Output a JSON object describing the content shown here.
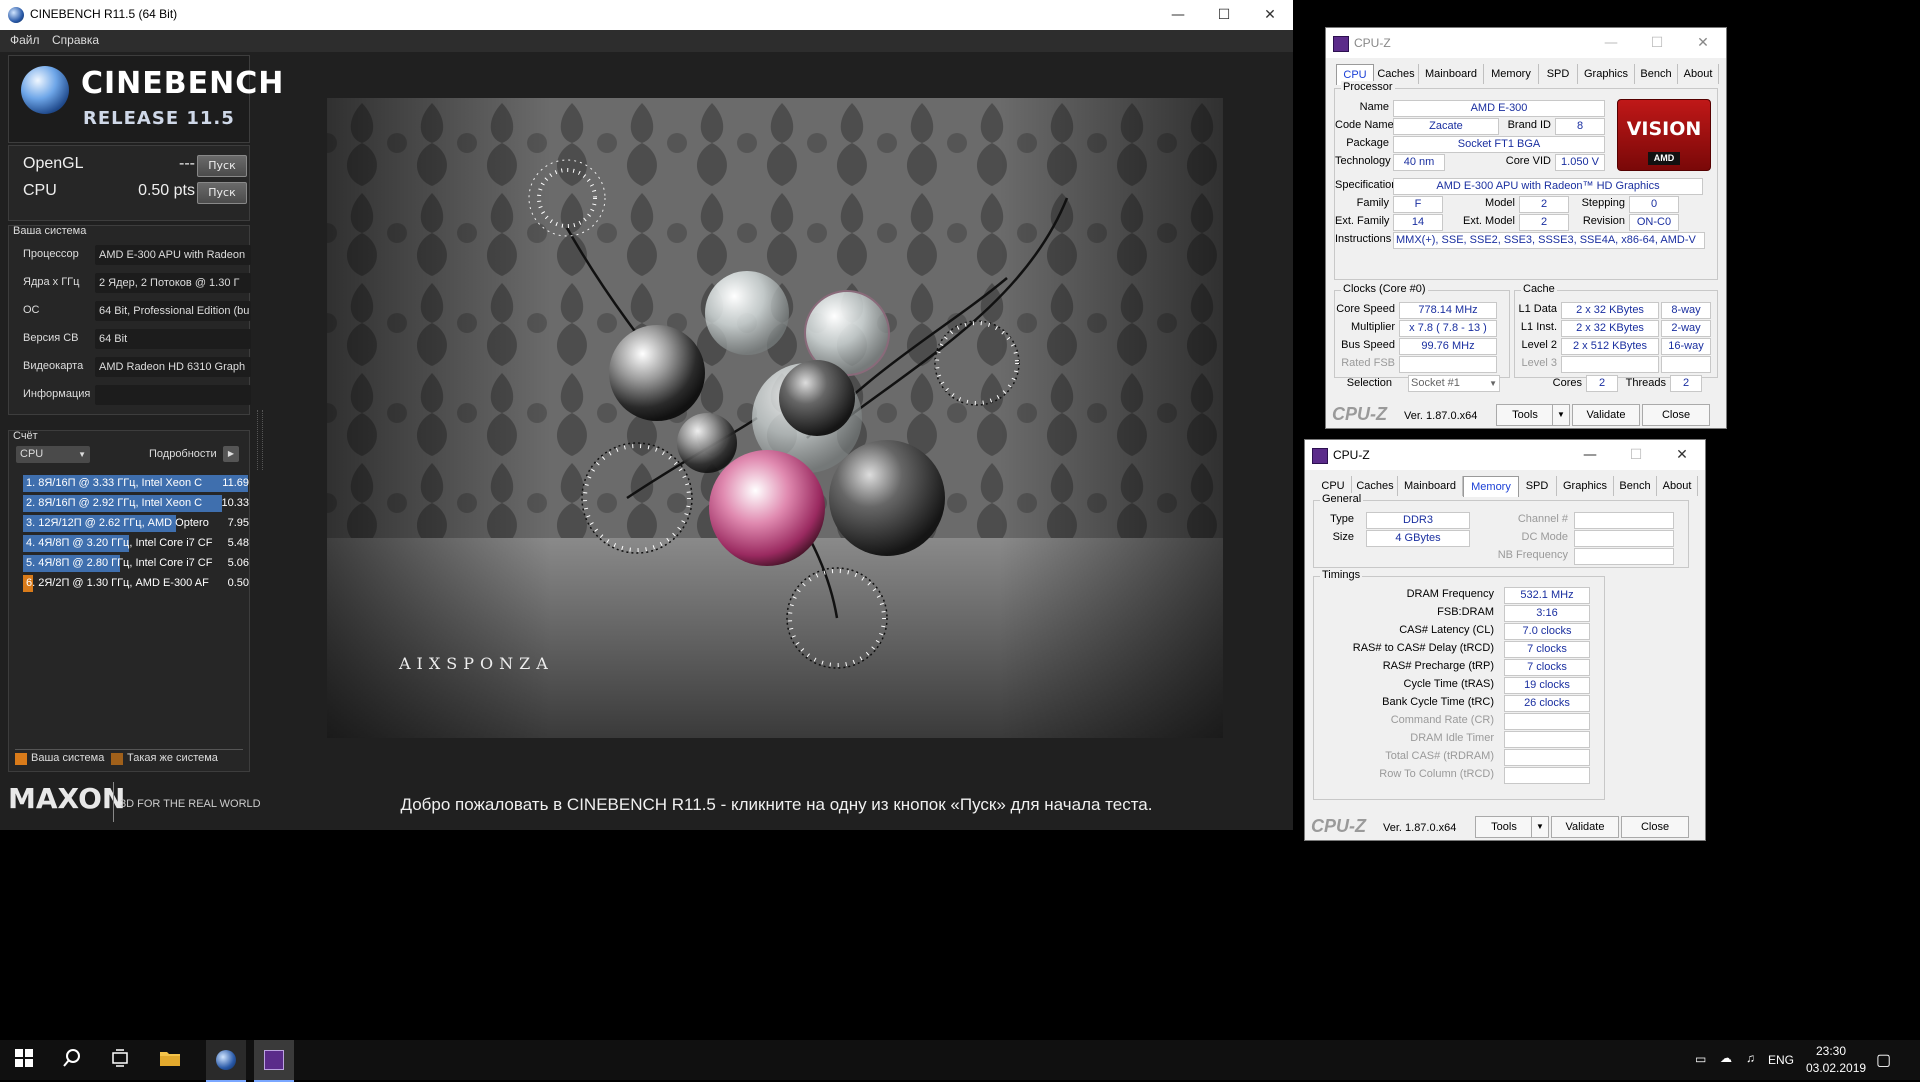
{
  "cinebench": {
    "title": "CINEBENCH R11.5 (64 Bit)",
    "menu": [
      "Файл",
      "Справка"
    ],
    "logo_line1": "CINEBENCH",
    "logo_line2": "RELEASE 11.5",
    "opengl_label": "OpenGL",
    "opengl_value": "---",
    "cpu_label": "CPU",
    "cpu_value": "0.50 pts",
    "run_label": "Пуск",
    "system_section": "Ваша система",
    "system": [
      {
        "label": "Процессор",
        "value": "AMD E-300 APU with Radeon"
      },
      {
        "label": "Ядра x ГГц",
        "value": "2 Ядер, 2 Потоков @ 1.30 Г"
      },
      {
        "label": "ОС",
        "value": "64 Bit, Professional Edition (bu"
      },
      {
        "label": "Версия СВ",
        "value": "64 Bit"
      },
      {
        "label": "Видеокарта",
        "value": "AMD Radeon HD 6310 Graph"
      },
      {
        "label": "Информация",
        "value": ""
      }
    ],
    "score_section": "Счёт",
    "score_select": "CPU",
    "details_label": "Подробности",
    "ranking": [
      {
        "text": "1. 8Я/16П @ 3.33 ГГц, Intel Xeon C",
        "score": "11.69",
        "fill": 1.0
      },
      {
        "text": "2. 8Я/16П @ 2.92 ГГц, Intel Xeon C",
        "score": "10.33",
        "fill": 0.884
      },
      {
        "text": "3. 12Я/12П @ 2.62 ГГц, AMD Optero",
        "score": "7.95",
        "fill": 0.68
      },
      {
        "text": "4. 4Я/8П @ 3.20 ГГц, Intel Core i7 CF",
        "score": "5.48",
        "fill": 0.469
      },
      {
        "text": "5. 4Я/8П @ 2.80 ГГц, Intel Core i7 CF",
        "score": "5.06",
        "fill": 0.433
      },
      {
        "text": "6. 2Я/2П @ 1.30 ГГц, AMD E-300 AF",
        "score": "0.50",
        "fill": 0.043
      }
    ],
    "legend_your": "Ваша система",
    "legend_same": "Такая же система",
    "maxon": "MAXON",
    "maxon_tag": "3D FOR THE REAL WORLD",
    "render_brand": "AIXSPONZA",
    "welcome": "Добро пожаловать в CINEBENCH R11.5 - кликните на одну из кнопок «Пуск» для начала теста."
  },
  "cpuz_cpu": {
    "title": "CPU-Z",
    "tabs": [
      "CPU",
      "Caches",
      "Mainboard",
      "Memory",
      "SPD",
      "Graphics",
      "Bench",
      "About"
    ],
    "processor_group": "Processor",
    "name_label": "Name",
    "name": "AMD E-300",
    "codename_label": "Code Name",
    "codename": "Zacate",
    "brandid_label": "Brand ID",
    "brandid": "8",
    "package_label": "Package",
    "package": "Socket FT1 BGA",
    "tech_label": "Technology",
    "tech": "40 nm",
    "corevid_label": "Core VID",
    "corevid": "1.050 V",
    "spec_label": "Specification",
    "spec": "AMD E-300 APU with Radeon™ HD Graphics",
    "family_label": "Family",
    "family": "F",
    "model_label": "Model",
    "model": "2",
    "stepping_label": "Stepping",
    "stepping": "0",
    "extfamily_label": "Ext. Family",
    "extfamily": "14",
    "extmodel_label": "Ext. Model",
    "extmodel": "2",
    "revision_label": "Revision",
    "revision": "ON-C0",
    "instr_label": "Instructions",
    "instr": "MMX(+), SSE, SSE2, SSE3, SSSE3, SSE4A, x86-64, AMD-V",
    "clocks_group": "Clocks (Core #0)",
    "corespeed_label": "Core Speed",
    "corespeed": "778.14 MHz",
    "multiplier_label": "Multiplier",
    "multiplier": "x 7.8 ( 7.8 - 13 )",
    "busspeed_label": "Bus Speed",
    "busspeed": "99.76 MHz",
    "ratedfsb_label": "Rated FSB",
    "cache_group": "Cache",
    "l1d_label": "L1 Data",
    "l1d": "2 x 32 KBytes",
    "l1d_way": "8-way",
    "l1i_label": "L1 Inst.",
    "l1i": "2 x 32 KBytes",
    "l1i_way": "2-way",
    "l2_label": "Level 2",
    "l2": "2 x 512 KBytes",
    "l2_way": "16-way",
    "l3_label": "Level 3",
    "selection_label": "Selection",
    "selection": "Socket #1",
    "cores_label": "Cores",
    "cores": "2",
    "threads_label": "Threads",
    "threads": "2",
    "vision_text": "VISION",
    "vision_sub": "AMD",
    "logo": "CPU-Z",
    "version": "Ver. 1.87.0.x64",
    "tools": "Tools",
    "validate": "Validate",
    "close": "Close"
  },
  "cpuz_mem": {
    "title": "CPU-Z",
    "tabs": [
      "CPU",
      "Caches",
      "Mainboard",
      "Memory",
      "SPD",
      "Graphics",
      "Bench",
      "About"
    ],
    "general_group": "General",
    "type_label": "Type",
    "type": "DDR3",
    "size_label": "Size",
    "size": "4 GBytes",
    "channel_label": "Channel #",
    "dcmode_label": "DC Mode",
    "nbfreq_label": "NB Frequency",
    "timings_group": "Timings",
    "timings": [
      {
        "label": "DRAM Frequency",
        "value": "532.1 MHz"
      },
      {
        "label": "FSB:DRAM",
        "value": "3:16"
      },
      {
        "label": "CAS# Latency (CL)",
        "value": "7.0 clocks"
      },
      {
        "label": "RAS# to CAS# Delay (tRCD)",
        "value": "7 clocks"
      },
      {
        "label": "RAS# Precharge (tRP)",
        "value": "7 clocks"
      },
      {
        "label": "Cycle Time (tRAS)",
        "value": "19 clocks"
      },
      {
        "label": "Bank Cycle Time (tRC)",
        "value": "26 clocks"
      }
    ],
    "timings_dim": [
      "Command Rate (CR)",
      "DRAM Idle Timer",
      "Total CAS# (tRDRAM)",
      "Row To Column (tRCD)"
    ],
    "logo": "CPU-Z",
    "version": "Ver. 1.87.0.x64",
    "tools": "Tools",
    "validate": "Validate",
    "close": "Close"
  },
  "taskbar": {
    "lang": "ENG",
    "time": "23:30",
    "date": "03.02.2019"
  }
}
